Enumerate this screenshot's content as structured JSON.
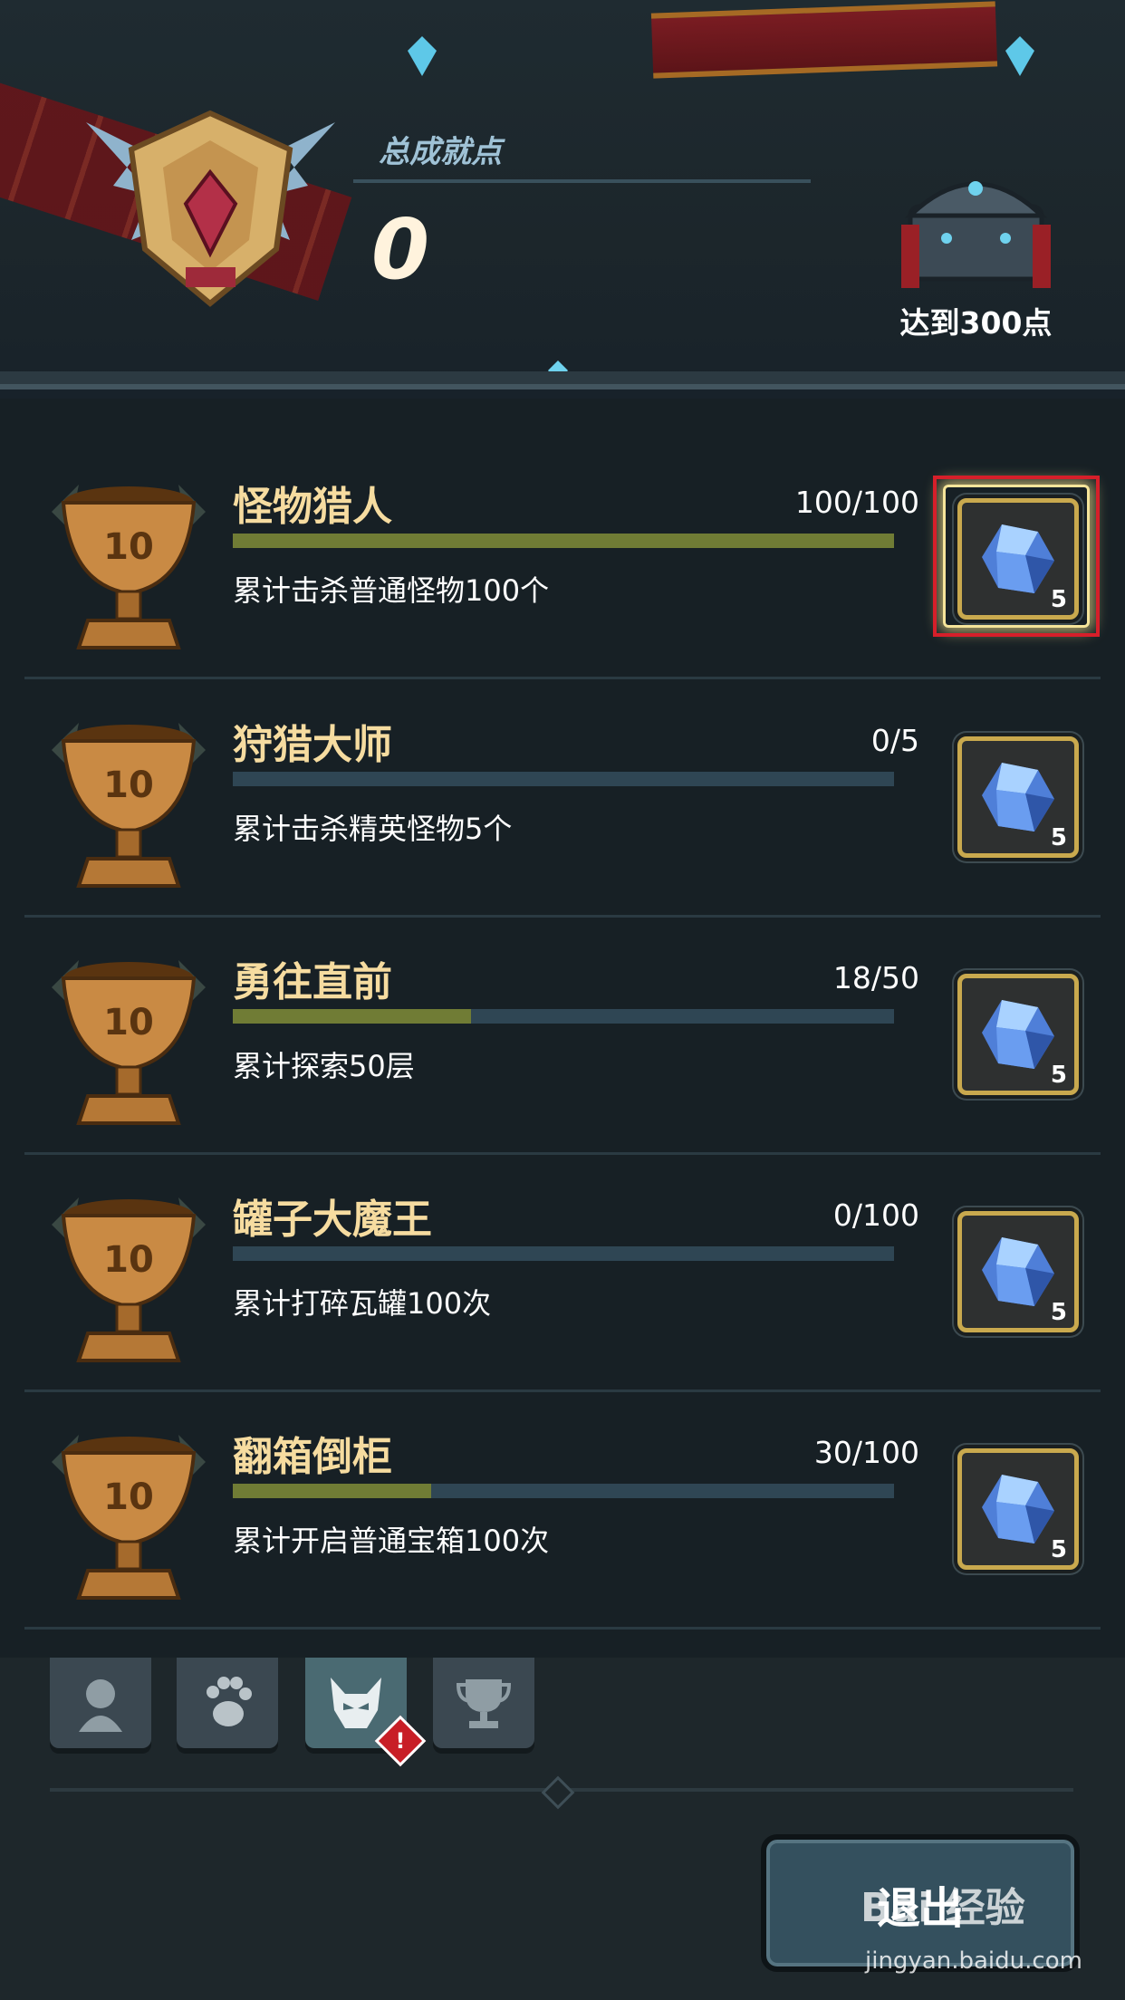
{
  "header": {
    "total_label": "总成就点",
    "total_value": "0",
    "chest_label": "达到300点"
  },
  "achievements": [
    {
      "title": "怪物猎人",
      "progress": "100/100",
      "fill": 1.0,
      "desc": "累计击杀普通怪物100个",
      "cup_value": "10",
      "reward_count": "5",
      "highlighted": true
    },
    {
      "title": "狩猎大师",
      "progress": "0/5",
      "fill": 0.0,
      "desc": "累计击杀精英怪物5个",
      "cup_value": "10",
      "reward_count": "5",
      "highlighted": false
    },
    {
      "title": "勇往直前",
      "progress": "18/50",
      "fill": 0.36,
      "desc": "累计探索50层",
      "cup_value": "10",
      "reward_count": "5",
      "highlighted": false
    },
    {
      "title": "罐子大魔王",
      "progress": "0/100",
      "fill": 0.0,
      "desc": "累计打碎瓦罐100次",
      "cup_value": "10",
      "reward_count": "5",
      "highlighted": false
    },
    {
      "title": "翻箱倒柜",
      "progress": "30/100",
      "fill": 0.3,
      "desc": "累计开启普通宝箱100次",
      "cup_value": "10",
      "reward_count": "5",
      "highlighted": false
    }
  ],
  "tabs": [
    {
      "icon": "character-icon",
      "active": false
    },
    {
      "icon": "paw-icon",
      "active": false
    },
    {
      "icon": "monster-icon",
      "active": true,
      "alert": "!"
    },
    {
      "icon": "trophy-icon",
      "active": false
    }
  ],
  "exit_label": "退出",
  "watermark": {
    "brand": "Bai 经验",
    "url": "jingyan.baidu.com"
  },
  "colors": {
    "title": "#f6dca0",
    "bar_fill": "#707c35",
    "bar_bg": "#2f4654",
    "highlight": "#d61f2a",
    "gold_frame": "#c9a94e"
  }
}
